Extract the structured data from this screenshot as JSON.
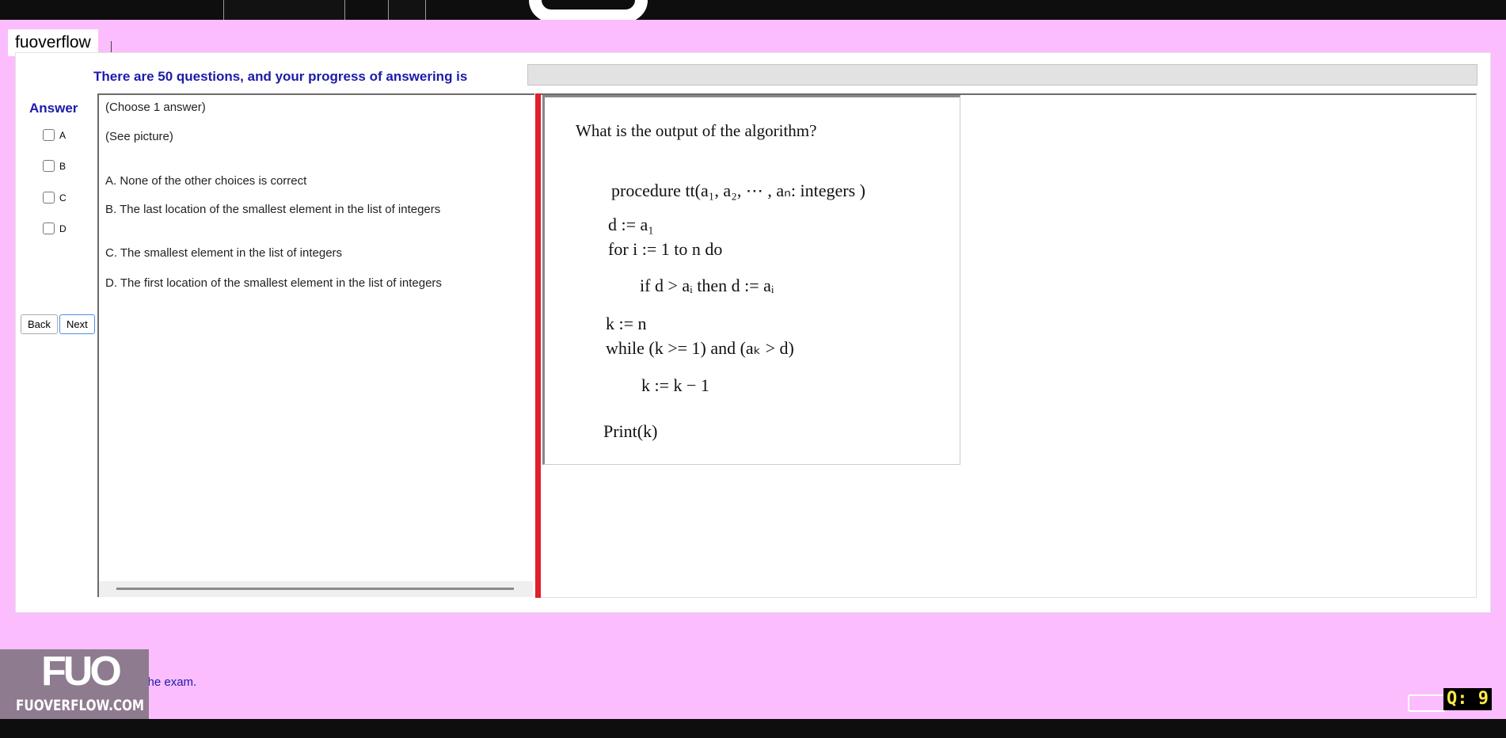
{
  "watermark_name": "fuoverflow",
  "progress": {
    "label": "There are 50 questions, and your progress of answering is",
    "value": 0
  },
  "answer_panel": {
    "title": "Answer",
    "options": [
      "A",
      "B",
      "C",
      "D"
    ],
    "back_label": "Back",
    "next_label": "Next"
  },
  "question": {
    "instruction": "(Choose 1 answer)",
    "see_picture": "(See picture)",
    "choices": [
      "A.  None of the other choices is correct",
      "B.  The last location of the smallest element in the list of integers",
      "C.  The smallest element in the list of integers",
      "D.  The first location of the smallest element in the list of integers"
    ]
  },
  "image_content": {
    "prompt": "What is the output of the algorithm?",
    "lines": {
      "procedure": "procedure tt(a₁, a₂, ⋯ , aₙ: integers )",
      "assign_d": "d := a₁",
      "for_loop": "for i := 1 to n do",
      "if_stmt": "if d > aᵢ then d := aᵢ",
      "assign_k": "k := n",
      "while_loop": "while (k >= 1) and (aₖ > d)",
      "decrement": "k := k − 1",
      "print": "Print(k)"
    }
  },
  "footer": {
    "logo_text": "FUO",
    "logo_site": "FUOVERFLOW.COM",
    "finish_label": "ish the exam.",
    "question_badge": "Q: 9"
  }
}
